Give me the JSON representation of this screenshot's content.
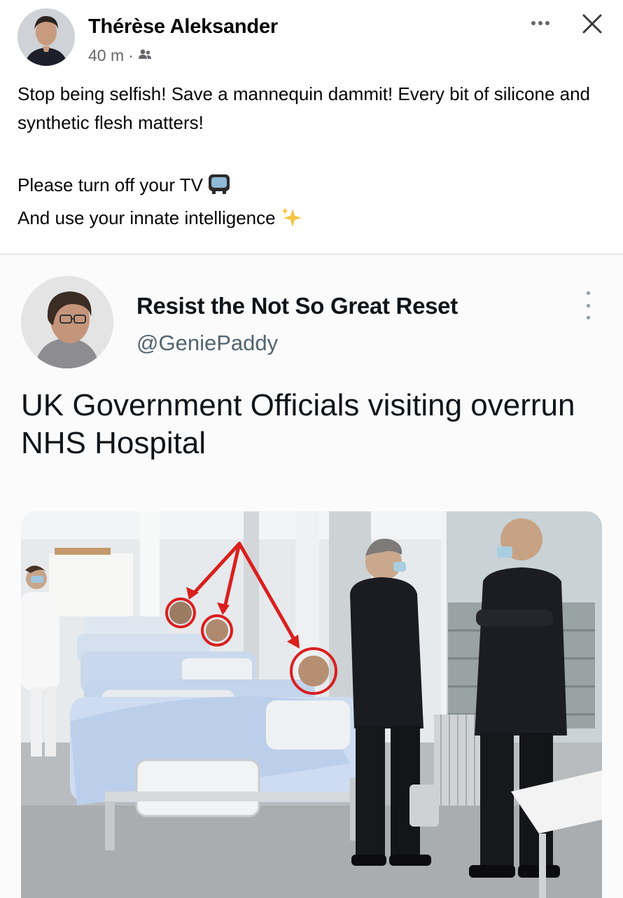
{
  "fb_post": {
    "author": "Thérèse Aleksander",
    "time": "40 m",
    "separator": "·",
    "audience_icon": "friends-icon",
    "body": {
      "line1": "Stop being selfish! Save a mannequin dammit! Every bit of silicone and synthetic flesh matters!",
      "line2": "Please turn off your TV",
      "line2_emoji": "tv-icon",
      "line3": "And use your innate intelligence",
      "line3_emoji": "sparkles-icon"
    }
  },
  "shared_tweet": {
    "display_name": "Resist the Not So Great Reset",
    "handle": "@GeniePaddy",
    "text": "UK Government Officials visiting overrun NHS Hospital",
    "media": {
      "scene": "hospital-ward-photo",
      "annotations": "red arrows pointing to three circled patient heads"
    }
  },
  "colors": {
    "text_primary": "#050505",
    "text_secondary": "#65676b",
    "tweet_handle": "#536471",
    "annotation_red": "#d9201f"
  }
}
